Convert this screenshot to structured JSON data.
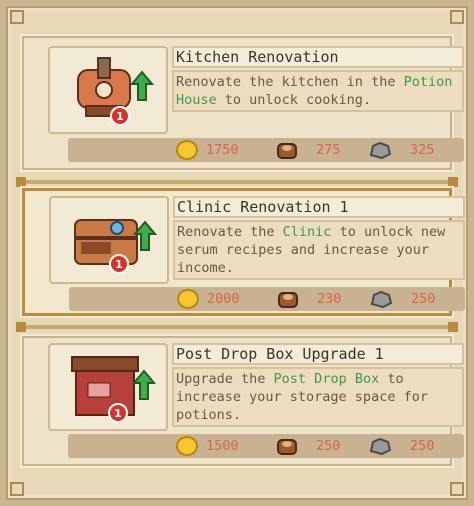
{
  "upgrades": [
    {
      "title": "Kitchen Renovation",
      "desc_pre": "Renovate the kitchen in the ",
      "desc_link": "Potion House",
      "desc_post": " to unlock cooking.",
      "level_badge": "1",
      "icon": "kitchen-stove-icon",
      "costs": {
        "gold": "1750",
        "wood": "275",
        "stone": "325"
      }
    },
    {
      "title": "Clinic Renovation 1",
      "desc_pre": "Renovate the ",
      "desc_link": "Clinic",
      "desc_post": " to unlock new serum recipes and increase your income.",
      "level_badge": "1",
      "icon": "clinic-chest-icon",
      "costs": {
        "gold": "2000",
        "wood": "230",
        "stone": "250"
      }
    },
    {
      "title": "Post Drop Box Upgrade 1",
      "desc_pre": "Upgrade the ",
      "desc_link": "Post Drop Box",
      "desc_post": " to increase your storage space for potions.",
      "level_badge": "1",
      "icon": "drop-box-icon",
      "costs": {
        "gold": "1500",
        "wood": "250",
        "stone": "250"
      }
    }
  ],
  "colors": {
    "link_green": "#3f9a45",
    "cost_red": "#d8654d",
    "selected_border": "#b88c3c"
  }
}
